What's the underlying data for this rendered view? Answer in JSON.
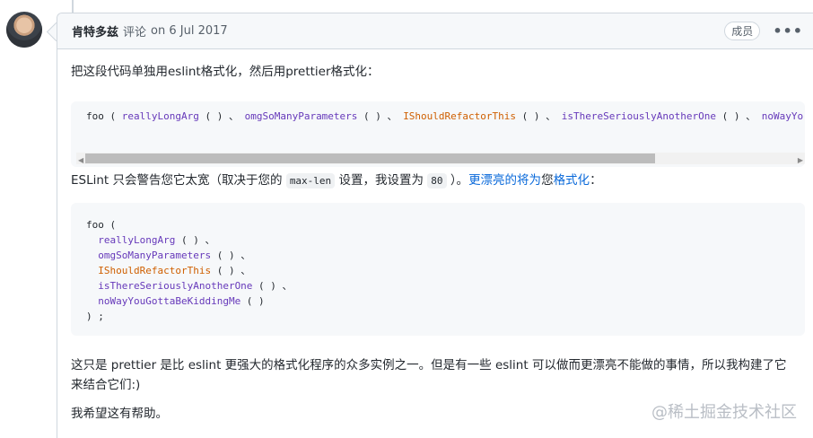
{
  "comment": {
    "author": "肯特多兹",
    "action": "评论",
    "date": "on 6 Jul 2017",
    "badge": "成员",
    "more_icon": "kebab-horizontal-icon",
    "paragraphs": {
      "p1": "把这段代码单独用eslint格式化，然后用prettier格式化：",
      "p2_before": "ESLint 只会警告您它太宽（取决于您的",
      "p2_code1": "max-len",
      "p2_mid": "设置，我设置为",
      "p2_code2": "80",
      "p2_after": "）。",
      "p2_link": "更漂亮的将为",
      "p2_after2": "您",
      "p2_link2": "格式化",
      "p2_end": "：",
      "p3": "这只是 prettier 是比 eslint 更强大的格式化程序的众多实例之一。但是有一些 eslint 可以做而更漂亮不能做的事情，所以我构建了它来结合它们:)",
      "p4": "我希望这有帮助。"
    },
    "code_block_1": {
      "t1": "foo",
      "t2": " ( ",
      "t3": "reallyLongArg",
      "t4": " ( ) 、 ",
      "t5": "omgSoManyParameters",
      "t6": " ( ) 、 ",
      "t7": "IShouldRefactorThis",
      "t8": " ( ) 、 ",
      "t9": "isThereSeriouslyAnotherOne",
      "t10": " ( ) 、 ",
      "t11": "noWayYo"
    },
    "code_block_2": {
      "l1a": "foo",
      "l1b": " (",
      "l2a": "  reallyLongArg",
      "l2b": " ( ) 、",
      "l3a": "  omgSoManyParameters",
      "l3b": " ( ) 、",
      "l4a": "  IShouldRefactorThis",
      "l4b": " ( ) 、",
      "l5a": "  isThereSeriouslyAnotherOne",
      "l5b": " ( ) 、",
      "l6a": "  noWayYouGottaBeKiddingMe",
      "l6b": " ( )",
      "l7": ") ;"
    }
  },
  "watermark": "@稀土掘金技术社区",
  "colors": {
    "link": "#0969da",
    "function": "#6639ba",
    "highlight": "#cf5f00"
  }
}
